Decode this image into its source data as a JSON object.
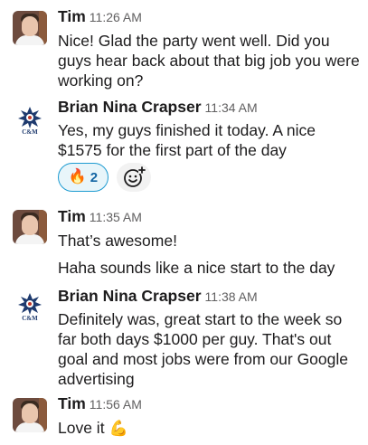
{
  "messages": [
    {
      "author": "Tim",
      "time": "11:26 AM",
      "text": "Nice! Glad the party went well. Did you guys hear back about that big job you were working on?"
    },
    {
      "author": "Brian Nina Crapser",
      "time": "11:34 AM",
      "text": "Yes, my guys finished it today. A nice $1575 for the first part of the day",
      "reaction": {
        "emoji": "🔥",
        "count": "2"
      }
    },
    {
      "author": "Tim",
      "time": "11:35 AM",
      "text": "That’s awesome!",
      "text2": "Haha sounds like a nice start to the day"
    },
    {
      "author": "Brian Nina Crapser",
      "time": "11:38 AM",
      "text": "Definitely was, great start to the week so far both days $1000 per guy. That's out goal and most jobs were from our Google advertising"
    },
    {
      "author": "Tim",
      "time": "11:56 AM",
      "text": "Love it",
      "emoji": "💪"
    }
  ],
  "logo_text": "C&M",
  "colors": {
    "reaction_bg": "#e8f5fa",
    "reaction_border": "#1d9bd1",
    "reaction_count": "#1264a3",
    "timestamp": "#616061"
  }
}
